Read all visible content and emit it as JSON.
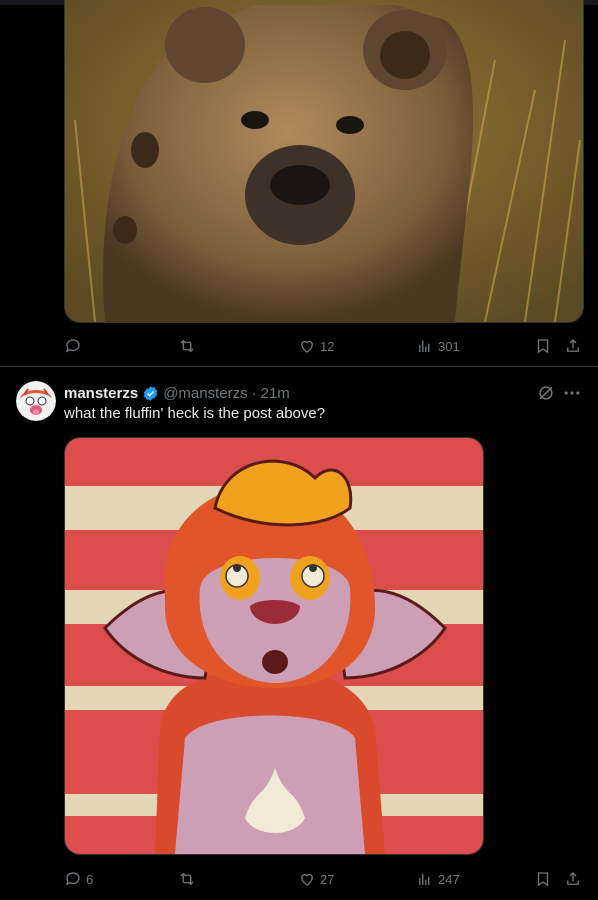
{
  "post1": {
    "image_alt": "hyena photo",
    "actions": {
      "reply_count": "",
      "repost_count": "",
      "like_count": "12",
      "views_count": "301"
    }
  },
  "post2": {
    "display_name": "mansterzs",
    "handle": "@mansterzs",
    "separator": "·",
    "time": "21m",
    "text": "what the fluffin' heck is the post above?",
    "image_alt": "cartoon tiger illustration",
    "actions": {
      "reply_count": "6",
      "repost_count": "",
      "like_count": "27",
      "views_count": "247"
    }
  },
  "colors": {
    "accent": "#f91880",
    "verified": "#1d9bf0",
    "muted": "#71767b"
  },
  "icons": [
    "reply-icon",
    "repost-icon",
    "like-icon",
    "views-icon",
    "bookmark-icon",
    "share-icon",
    "verified-badge-icon",
    "grok-icon",
    "more-icon"
  ]
}
